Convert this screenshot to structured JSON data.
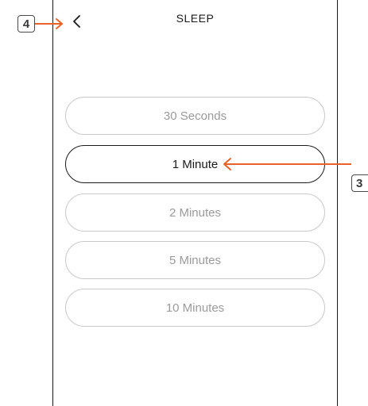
{
  "header": {
    "title": "SLEEP",
    "back_icon": "chevron-left-icon"
  },
  "sleep_options": [
    {
      "label": "30 Seconds",
      "selected": false
    },
    {
      "label": "1 Minute",
      "selected": true
    },
    {
      "label": "2 Minutes",
      "selected": false
    },
    {
      "label": "5 Minutes",
      "selected": false
    },
    {
      "label": "10 Minutes",
      "selected": false
    }
  ],
  "callouts": {
    "back": "4",
    "selected_option": "3"
  },
  "colors": {
    "callout_arrow": "#e8622a",
    "selected_border": "#1a1a1a",
    "unselected_border": "#c9c9c9",
    "unselected_text": "#9b9b9b"
  }
}
